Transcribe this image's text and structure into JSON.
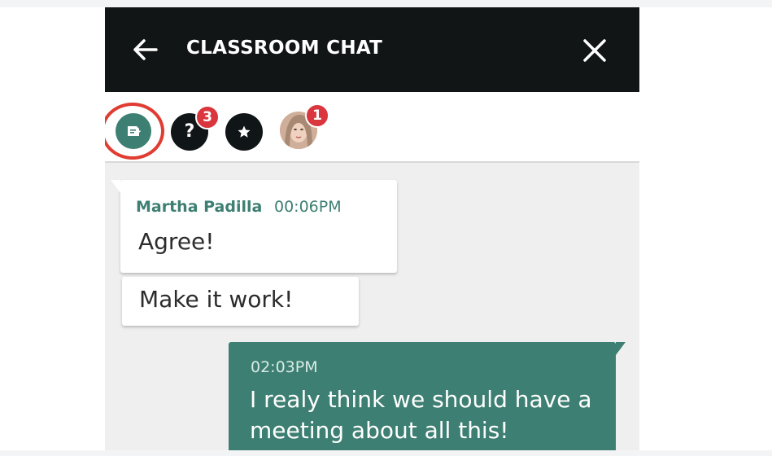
{
  "header": {
    "title": "CLASSROOM CHAT",
    "back_icon": "arrow-left-icon",
    "close_icon": "close-icon"
  },
  "filters": {
    "notes_icon": "note-icon",
    "questions_glyph": "?",
    "questions_badge": "3",
    "starred_icon": "star-icon",
    "user_badge": "1"
  },
  "messages": [
    {
      "sender": "Martha Padilla",
      "time": "00:06PM",
      "text": "Agree!"
    },
    {
      "text": "Make it work!"
    },
    {
      "time": "02:03PM",
      "text": "I realy think we should have a meeting about all this!",
      "own": true
    }
  ],
  "colors": {
    "header_bg": "#111516",
    "accent": "#3d7f72",
    "badge": "#d9363e",
    "highlight": "#e03c31"
  }
}
